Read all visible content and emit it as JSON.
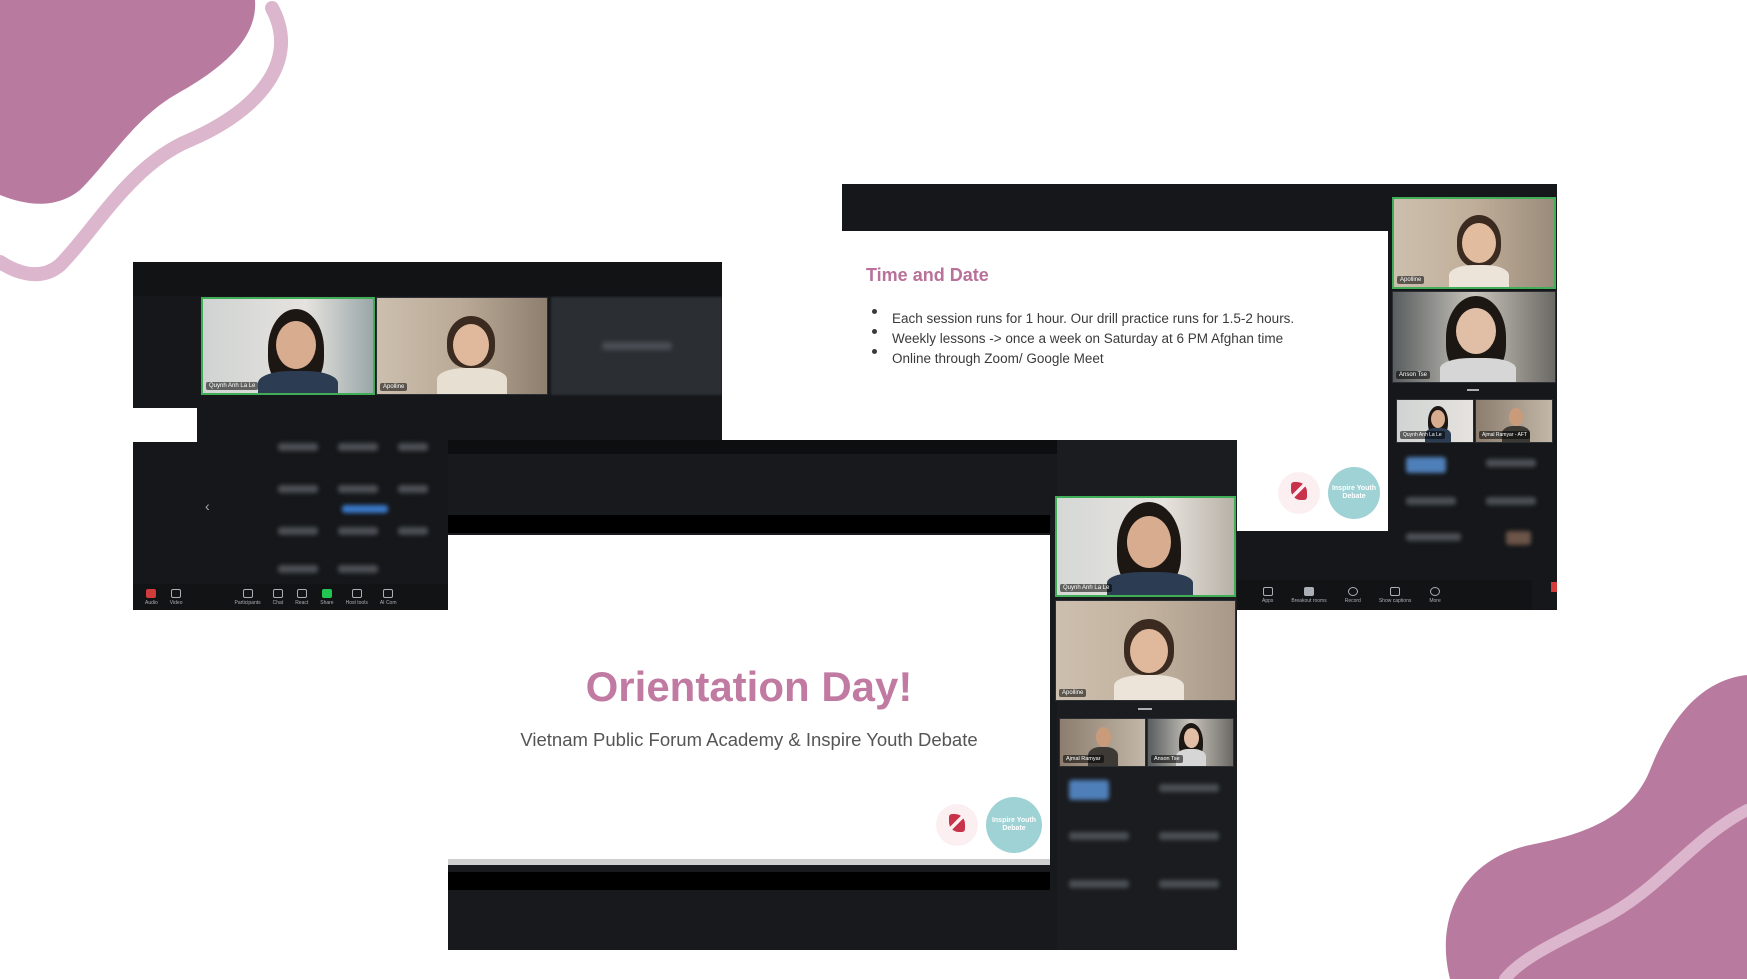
{
  "colors": {
    "blob": "#b97aa0",
    "blob_line": "#dbb6cc",
    "slide_title": "#c17aa2",
    "active_speaker": "#3fae56",
    "toolbar_bg": "#111315",
    "teal_logo": "#9fd2d4"
  },
  "left_screenshot": {
    "participants": [
      {
        "name": "Quynh Anh La Le",
        "active": true
      },
      {
        "name": "Apolline",
        "active": false
      }
    ],
    "toolbar": [
      {
        "icon": "mic-icon",
        "label": "Audio"
      },
      {
        "icon": "video-icon",
        "label": "Video"
      },
      {
        "icon": "participants-icon",
        "label": "Participants"
      },
      {
        "icon": "chat-icon",
        "label": "Chat"
      },
      {
        "icon": "react-icon",
        "label": "React"
      },
      {
        "icon": "share-icon",
        "label": "Share"
      },
      {
        "icon": "host-tools-icon",
        "label": "Host tools"
      },
      {
        "icon": "ai-companion-icon",
        "label": "AI Com"
      }
    ]
  },
  "right_screenshot": {
    "slide": {
      "heading": "Time and Date",
      "bullets": [
        "Each session runs for 1 hour. Our drill practice runs for 1.5-2 hours.",
        "Weekly lessons -> once a week on Saturday at 6 PM Afghan time",
        "Online through Zoom/ Google Meet"
      ]
    },
    "participants": [
      {
        "name": "Apolline",
        "active": true
      },
      {
        "name": "Anson Tse",
        "active": false
      },
      {
        "name": "Quynh Anh La Le",
        "active": false
      },
      {
        "name": "Ajmal Ramyar - AFT",
        "active": false
      }
    ],
    "toolbar": [
      {
        "icon": "apps-icon",
        "label": "Apps"
      },
      {
        "icon": "breakout-rooms-icon",
        "label": "Breakout rooms"
      },
      {
        "icon": "record-icon",
        "label": "Record"
      },
      {
        "icon": "captions-icon",
        "label": "Show captions"
      },
      {
        "icon": "more-icon",
        "label": "More"
      }
    ]
  },
  "center_screenshot": {
    "slide": {
      "title": "Orientation Day!",
      "subtitle": "Vietnam Public Forum Academy & Inspire Youth Debate",
      "logo_text": "Inspire Youth Debate"
    },
    "participants": [
      {
        "name": "Quynh Anh La Le",
        "active": true
      },
      {
        "name": "Apolline",
        "active": false
      },
      {
        "name": "Ajmal Ramyar",
        "active": false
      },
      {
        "name": "Anson Tse",
        "active": false
      }
    ]
  }
}
